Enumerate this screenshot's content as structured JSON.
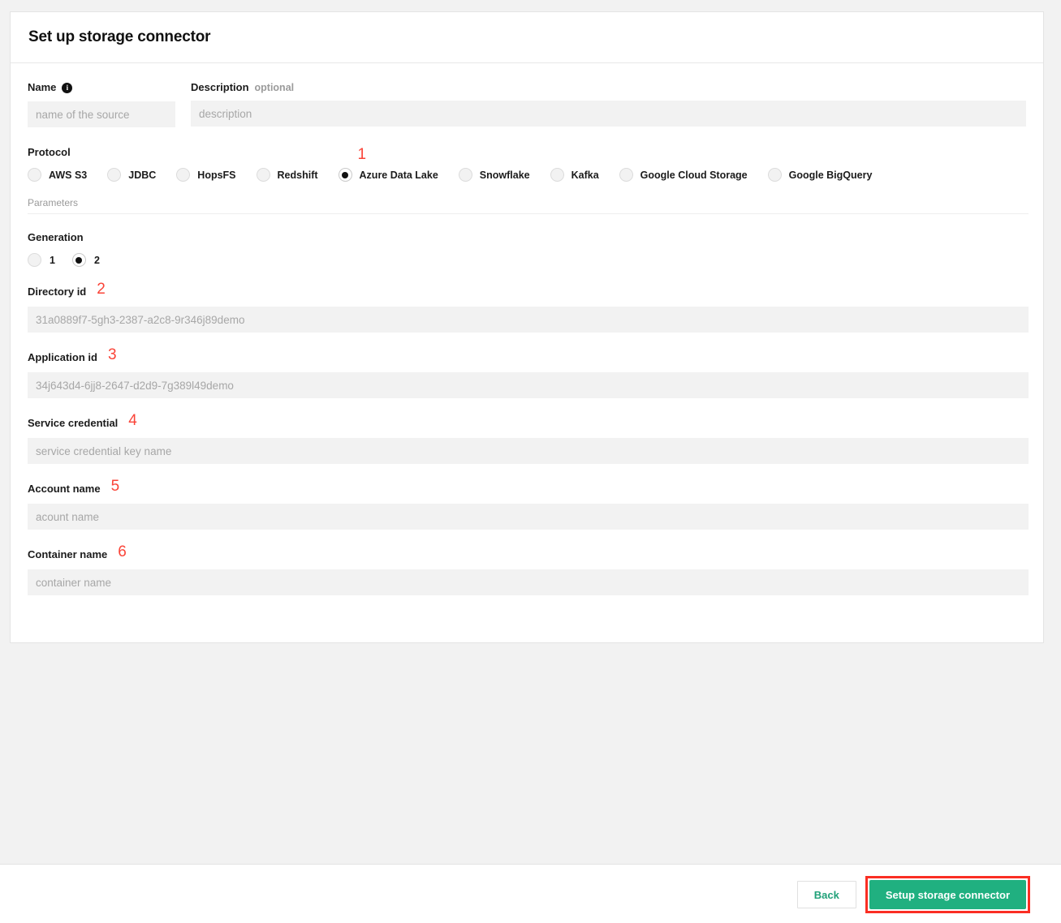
{
  "card": {
    "title": "Set up storage connector"
  },
  "name_field": {
    "label": "Name",
    "info_icon": "info-icon",
    "placeholder": "name of the source",
    "value": ""
  },
  "description_field": {
    "label": "Description",
    "optional_tag": "optional",
    "placeholder": "description",
    "value": ""
  },
  "protocol": {
    "label": "Protocol",
    "options": [
      {
        "label": "AWS S3",
        "selected": false
      },
      {
        "label": "JDBC",
        "selected": false
      },
      {
        "label": "HopsFS",
        "selected": false
      },
      {
        "label": "Redshift",
        "selected": false
      },
      {
        "label": "Azure Data Lake",
        "selected": true,
        "annotation": "1"
      },
      {
        "label": "Snowflake",
        "selected": false
      },
      {
        "label": "Kafka",
        "selected": false
      },
      {
        "label": "Google Cloud Storage",
        "selected": false
      },
      {
        "label": "Google BigQuery",
        "selected": false
      }
    ]
  },
  "parameters_section": {
    "label": "Parameters"
  },
  "generation": {
    "label": "Generation",
    "options": [
      {
        "label": "1",
        "selected": false
      },
      {
        "label": "2",
        "selected": true
      }
    ]
  },
  "fields": [
    {
      "label": "Directory id",
      "annotation": "2",
      "placeholder": "31a0889f7-5gh3-2387-a2c8-9r346j89demo",
      "value": ""
    },
    {
      "label": "Application id",
      "annotation": "3",
      "placeholder": "34j643d4-6jj8-2647-d2d9-7g389l49demo",
      "value": ""
    },
    {
      "label": "Service credential",
      "annotation": "4",
      "placeholder": "service credential key name",
      "value": ""
    },
    {
      "label": "Account name",
      "annotation": "5",
      "placeholder": "acount name",
      "value": ""
    },
    {
      "label": "Container name",
      "annotation": "6",
      "placeholder": "container name",
      "value": ""
    }
  ],
  "footer": {
    "back_label": "Back",
    "submit_label": "Setup storage connector"
  },
  "colors": {
    "accent_green": "#20b080",
    "annotation_red": "#fa4438",
    "highlight_red": "#fa2e23",
    "input_background": "#f2f2f2",
    "page_background": "#f2f2f2"
  }
}
